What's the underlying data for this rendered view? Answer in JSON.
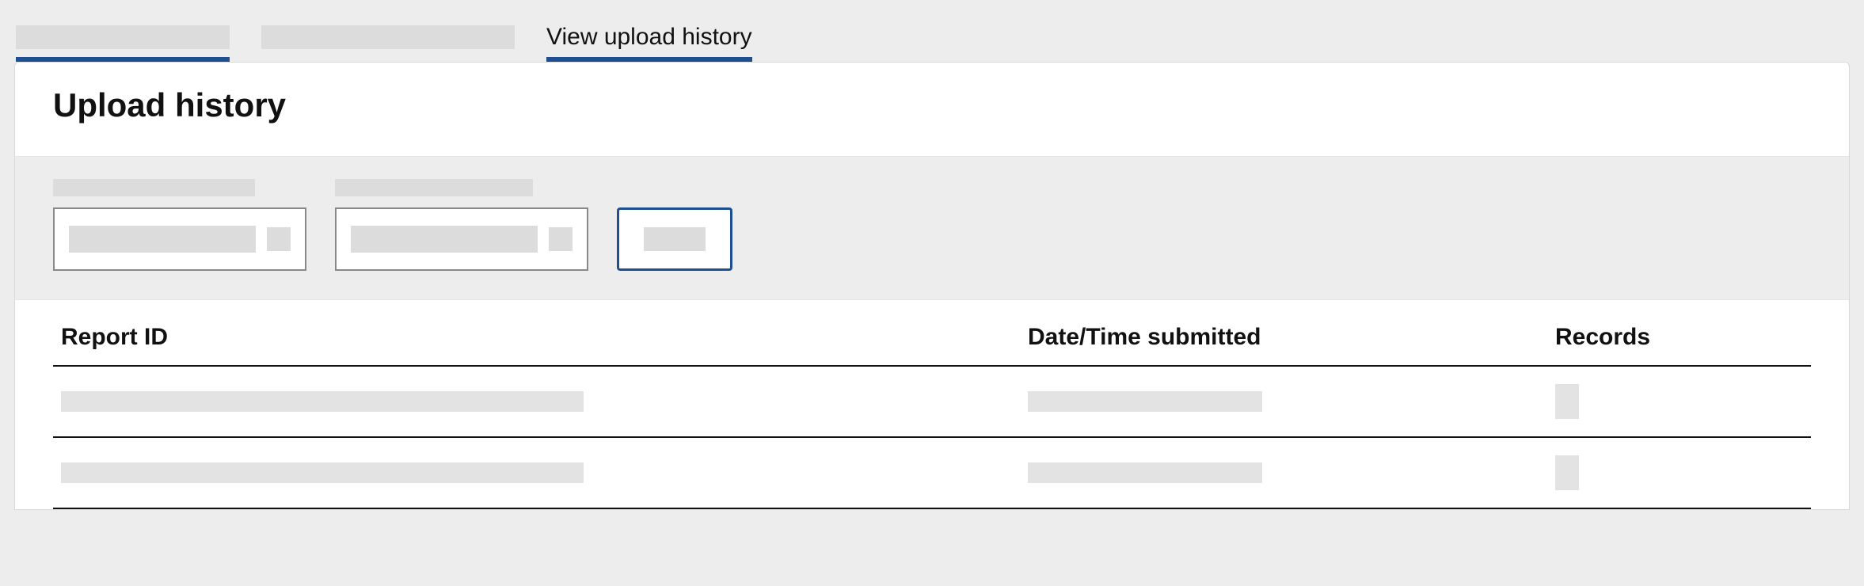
{
  "tabs": {
    "active_label": "View upload history"
  },
  "page": {
    "title": "Upload history"
  },
  "table": {
    "columns": {
      "report_id": "Report ID",
      "datetime": "Date/Time submitted",
      "records": "Records"
    }
  }
}
